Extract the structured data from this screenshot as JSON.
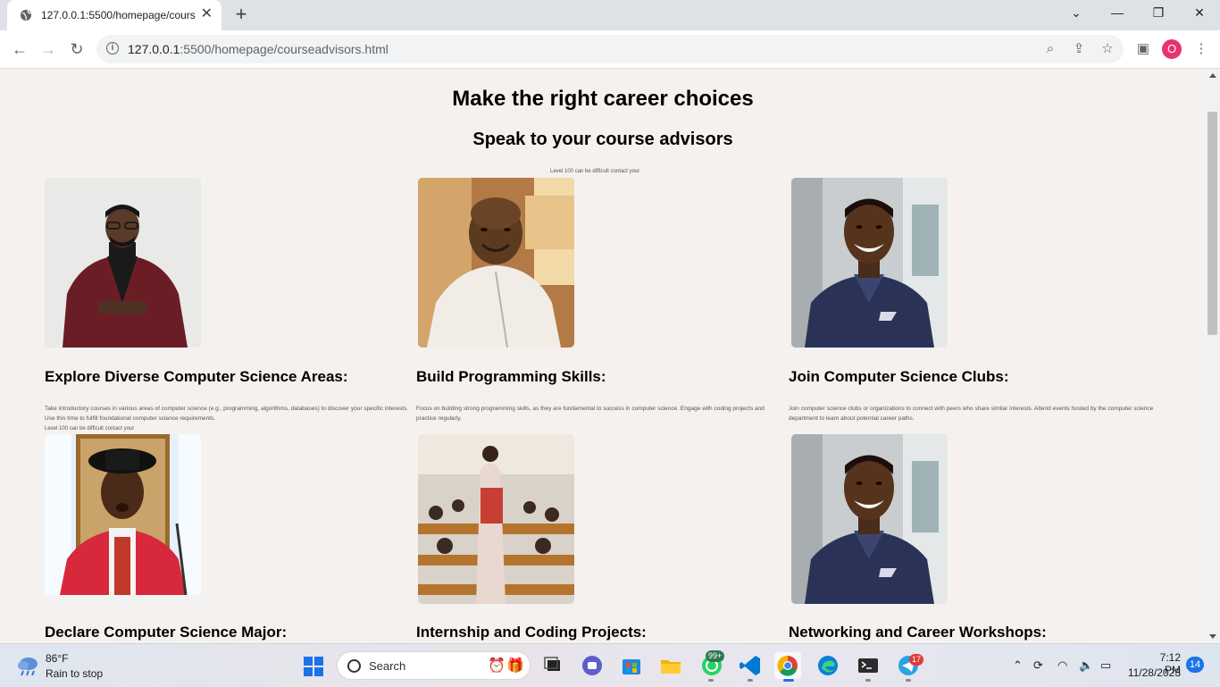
{
  "browser": {
    "tab_title": "127.0.0.1:5500/homepage/cours",
    "url_host": "127.0.0.1",
    "url_path": ":5500/homepage/courseadvisors.html",
    "profile_initial": "O"
  },
  "page": {
    "heading": "Make the right career choices",
    "subheading": "Speak to your course advisors",
    "top_note": "Level 100 can be difficult contact your",
    "row_note": "Level 100 can be difficult contact your",
    "cards": [
      {
        "title": "Explore Diverse Computer Science Areas:",
        "desc": "Take introductory courses in various areas of computer science (e.g., programming, algorithms, databases) to discover your specific interests. Use this time to fulfill foundational computer science requirements."
      },
      {
        "title": "Build Programming Skills:",
        "desc": "Focus on building strong programming skills, as they are fundamental to success in computer science. Engage with coding projects and practice regularly."
      },
      {
        "title": "Join Computer Science Clubs:",
        "desc": "Join computer science clubs or organizations to connect with peers who share similar interests. Attend events hosted by the computer science department to learn about potential career paths."
      },
      {
        "title": "Declare Computer Science Major:",
        "desc": ""
      },
      {
        "title": "Internship and Coding Projects:",
        "desc": ""
      },
      {
        "title": "Networking and Career Workshops:",
        "desc": ""
      }
    ]
  },
  "taskbar": {
    "weather_temp": "86°F",
    "weather_desc": "Rain to stop",
    "search_label": "Search",
    "whatsapp_badge": "99+",
    "telegram_badge": "17",
    "time": "7:12 PM",
    "date": "11/28/2023",
    "notifications": "14"
  }
}
